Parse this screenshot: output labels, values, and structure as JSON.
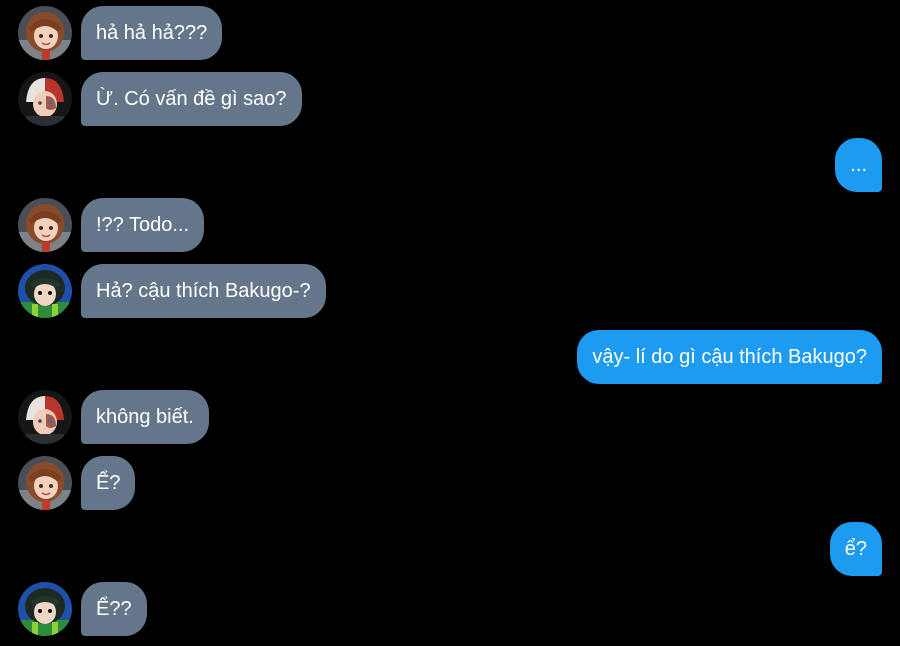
{
  "colors": {
    "background": "#000000",
    "received_bubble": "#66768a",
    "sent_bubble": "#1d9bf0",
    "text": "#ffffff"
  },
  "messages": [
    {
      "side": "left",
      "avatar": "uraraka-avatar",
      "text": "hả hả hả???"
    },
    {
      "side": "left",
      "avatar": "todoroki-avatar",
      "text": "Ừ. Có vấn đề gì sao?"
    },
    {
      "side": "right",
      "text": "..."
    },
    {
      "side": "left",
      "avatar": "uraraka-avatar",
      "text": "!?? Todo..."
    },
    {
      "side": "left",
      "avatar": "tsuyu-avatar",
      "text": "Hả? cậu thích Bakugo-?"
    },
    {
      "side": "right",
      "text": "vậy- lí do gì cậu thích Bakugo?"
    },
    {
      "side": "left",
      "avatar": "todoroki-avatar",
      "text": "không biết."
    },
    {
      "side": "left",
      "avatar": "uraraka-avatar",
      "text": "Ể?"
    },
    {
      "side": "right",
      "text": "ể?"
    },
    {
      "side": "left",
      "avatar": "tsuyu-avatar",
      "text": "Ể??"
    }
  ]
}
